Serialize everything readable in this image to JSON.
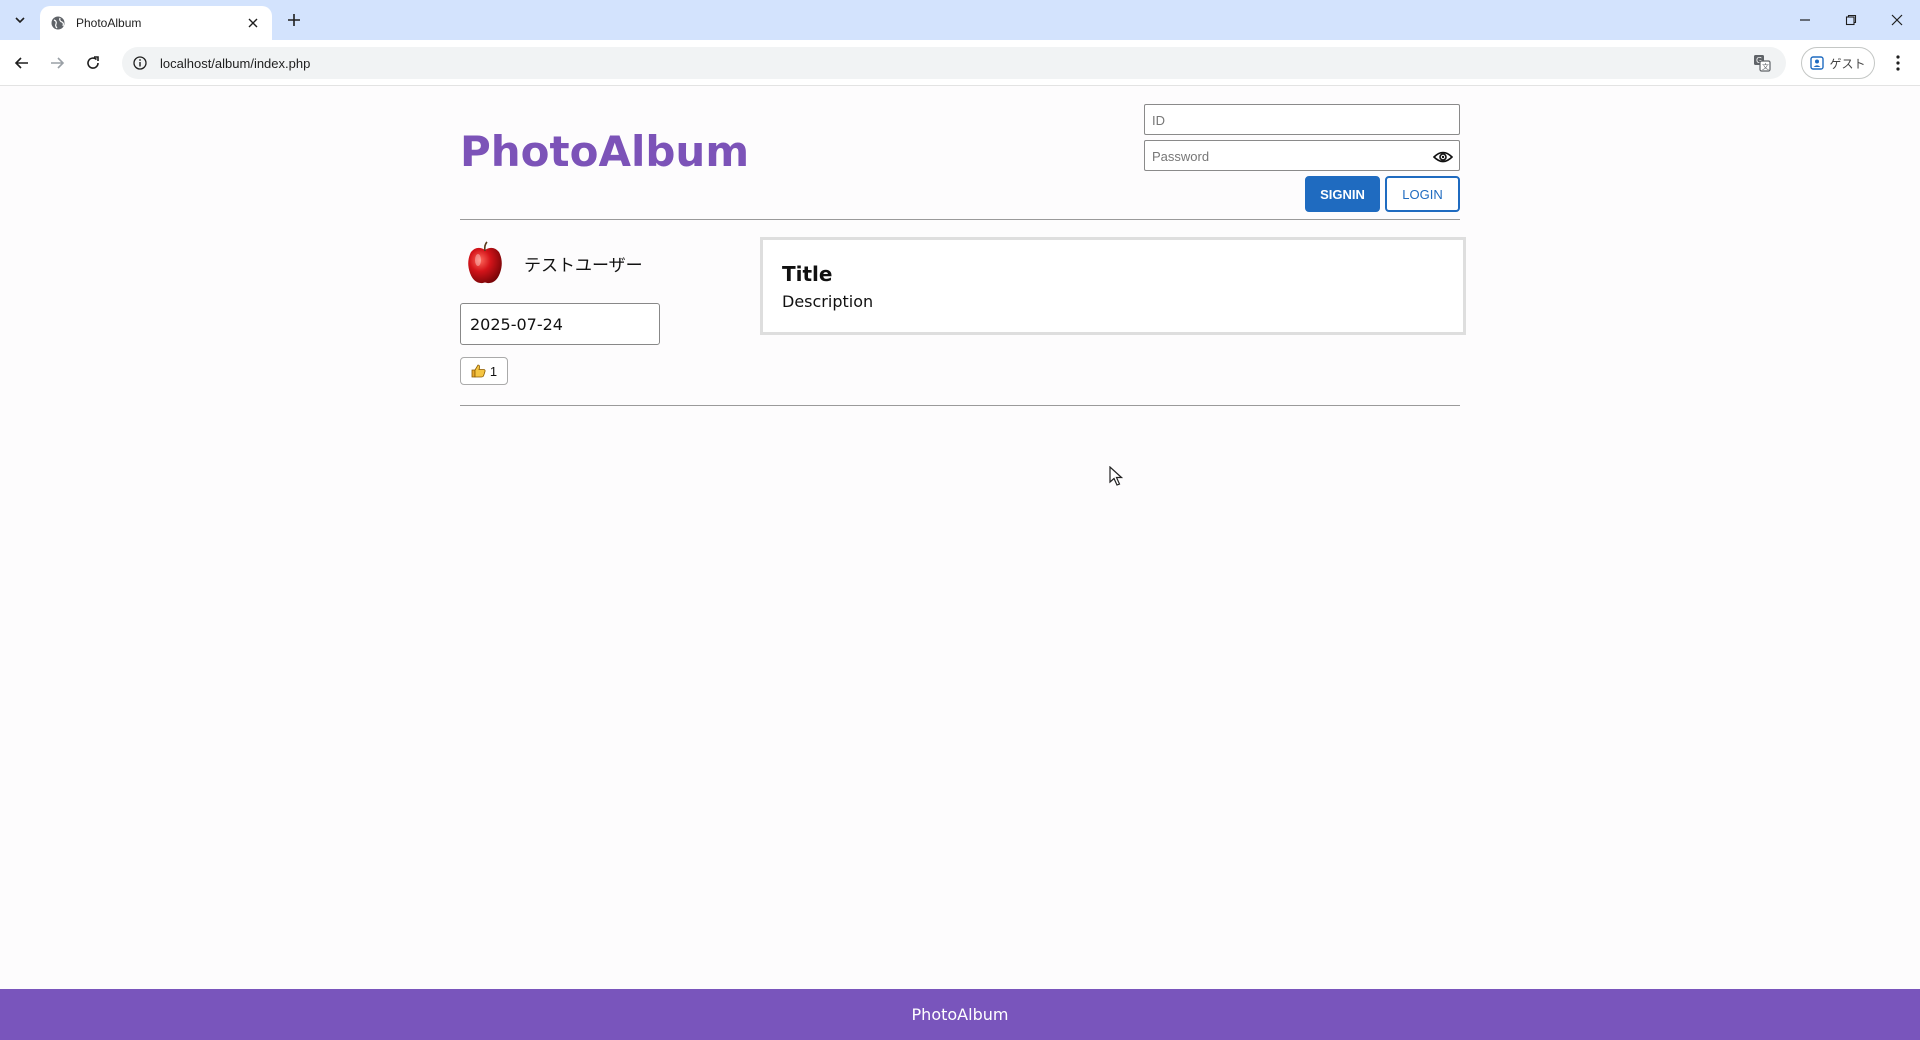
{
  "browser": {
    "tab_title": "PhotoAlbum",
    "url": "localhost/album/index.php",
    "profile_label": "ゲスト",
    "icons": {
      "tab_list": "chevron-down-icon",
      "favicon": "globe-icon",
      "close": "close-icon",
      "new_tab": "plus-icon",
      "back": "arrow-left-icon",
      "forward": "arrow-right-icon",
      "reload": "reload-icon",
      "site_info": "info-icon",
      "translate": "translate-icon",
      "profile": "person-icon",
      "menu": "more-vert-icon"
    }
  },
  "header": {
    "site_title": "PhotoAlbum",
    "title_color": "#7c53b8"
  },
  "login": {
    "id_placeholder": "ID",
    "password_placeholder": "Password",
    "signin_label": "SIGNIN",
    "login_label": "LOGIN",
    "accent_color": "#1f6bc0"
  },
  "post": {
    "username": "テストユーザー",
    "avatar": "apple-icon",
    "date": "2025-07-24",
    "like_icon": "thumbs-up-icon",
    "like_count": "1",
    "card_title": "Title",
    "card_description": "Description"
  },
  "footer": {
    "text": "PhotoAlbum",
    "color": "#7955bc"
  }
}
